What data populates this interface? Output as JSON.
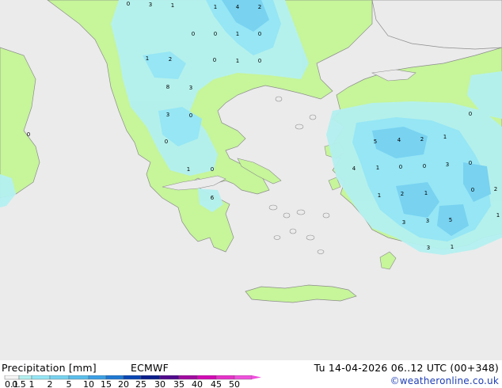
{
  "footer": {
    "title": "Precipitation [mm]",
    "model": "ECMWF",
    "valid": "Tu 14-04-2026 06..12 UTC (00+348)",
    "credit": "©weatheronline.co.uk"
  },
  "legend": {
    "ticks": [
      "0.1",
      "0.5",
      "1",
      "2",
      "5",
      "10",
      "15",
      "20",
      "25",
      "30",
      "35",
      "40",
      "45",
      "50"
    ],
    "colors": [
      "#f5f5f5",
      "#b4f0f0",
      "#96e6f5",
      "#78d2f0",
      "#5abeeb",
      "#3ca0e6",
      "#1e78d2",
      "#0a46b4",
      "#0a1e8c",
      "#500a8c",
      "#a00aa0",
      "#d20ab4",
      "#e632c8",
      "#f050dc"
    ]
  },
  "colors": {
    "sea": "#ebebeb",
    "land": "#c6f59a",
    "coast": "#8c8c8c",
    "rain_light": "#b4f0f0",
    "rain_mid": "#96e6f5",
    "rain_heavy": "#78d2f0"
  },
  "map_labels": [
    "0",
    "3",
    "1",
    "1",
    "4",
    "2",
    "0",
    "0",
    "1",
    "0",
    "1",
    "2",
    "0",
    "1",
    "0",
    "8",
    "3",
    "3",
    "0",
    "0",
    "1",
    "0",
    "6",
    "0",
    "0",
    "5",
    "4",
    "2",
    "1",
    "4",
    "1",
    "0",
    "0",
    "3",
    "0",
    "0",
    "2",
    "1",
    "2",
    "1",
    "3",
    "3",
    "5",
    "1",
    "3",
    "1"
  ]
}
